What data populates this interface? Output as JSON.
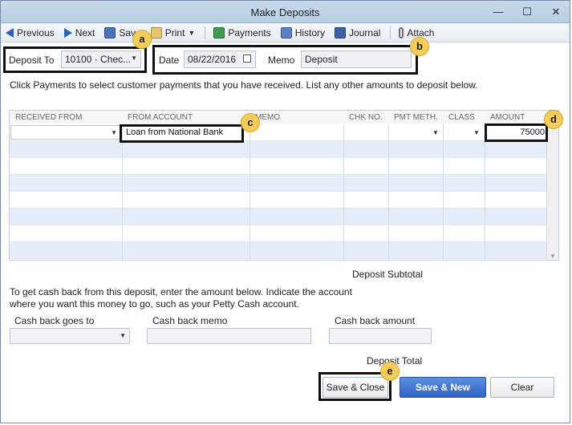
{
  "window": {
    "title": "Make Deposits",
    "controls": [
      "—",
      "☐",
      "✕"
    ]
  },
  "toolbar": {
    "previous": "Previous",
    "next": "Next",
    "save": "Save",
    "print": "Print",
    "payments": "Payments",
    "history": "History",
    "journal": "Journal",
    "attach": "Attach"
  },
  "header": {
    "deposit_to_label": "Deposit To",
    "deposit_to_value": "10100 · Chec...",
    "date_label": "Date",
    "date_value": "08/22/2016",
    "memo_label": "Memo",
    "memo_value": "Deposit"
  },
  "instructions": "Click Payments to select customer payments that you have received. List any other amounts to deposit below.",
  "grid": {
    "columns": [
      "RECEIVED FROM",
      "FROM ACCOUNT",
      "MEMO",
      "CHK NO.",
      "PMT METH.",
      "CLASS",
      "AMOUNT"
    ],
    "rows": [
      {
        "received_from": "",
        "from_account": "Loan from National Bank",
        "memo": "",
        "chk_no": "",
        "pmt_meth": "",
        "class": "",
        "amount": "75000"
      }
    ]
  },
  "footer": {
    "deposit_subtotal_label": "Deposit Subtotal",
    "cashback_instructions_line1": "To get cash back from this deposit, enter the amount below.  Indicate the account",
    "cashback_instructions_line2": "where you want this money to go, such as your Petty Cash account.",
    "cash_back_goes_to_label": "Cash back goes to",
    "cash_back_memo_label": "Cash back memo",
    "cash_back_amount_label": "Cash back amount",
    "deposit_total_label": "Deposit Total",
    "save_close": "Save & Close",
    "save_new": "Save & New",
    "clear": "Clear"
  },
  "annotations": {
    "a": "a",
    "b": "b",
    "c": "c",
    "d": "d",
    "e": "e"
  },
  "colors": {
    "annotation_badge": "#f3cc5a",
    "primary_button": "#2d64c5",
    "alt_row": "#e4edf9"
  }
}
